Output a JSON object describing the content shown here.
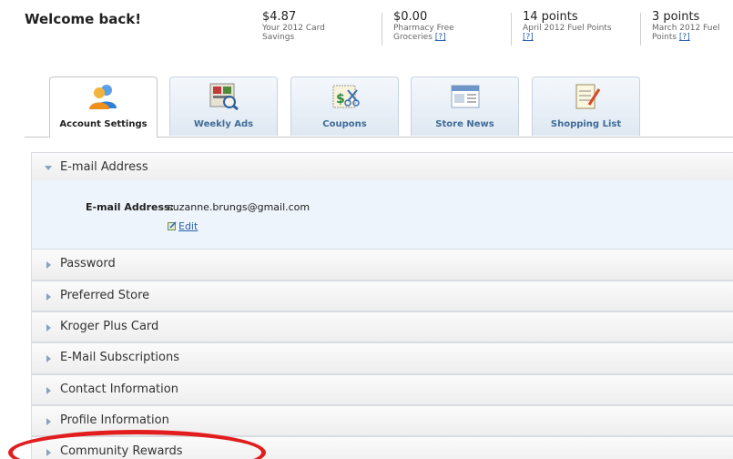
{
  "header": {
    "welcome": "Welcome back!"
  },
  "stats": [
    {
      "value": "$4.87",
      "desc1": "Your 2012 Card",
      "desc2": "Savings",
      "help": ""
    },
    {
      "value": "$0.00",
      "desc1": "Pharmacy Free",
      "desc2": "Groceries",
      "help": "[?]"
    },
    {
      "value": "14 points",
      "desc1": "April 2012 Fuel Points",
      "desc2": "",
      "help": "[?]"
    },
    {
      "value": "3 points",
      "desc1": "March 2012 Fuel",
      "desc2": "Points",
      "help": "[?]"
    }
  ],
  "tabs": [
    {
      "label": "Account Settings",
      "icon": "account-icon",
      "active": true
    },
    {
      "label": "Weekly Ads",
      "icon": "weekly-ads-icon",
      "active": false
    },
    {
      "label": "Coupons",
      "icon": "coupon-icon",
      "active": false
    },
    {
      "label": "Store News",
      "icon": "news-icon",
      "active": false
    },
    {
      "label": "Shopping List",
      "icon": "list-icon",
      "active": false
    }
  ],
  "sections": {
    "email": {
      "title": "E-mail Address",
      "field_label": "E-mail Address:",
      "field_value": "suzanne.brungs@gmail.com",
      "edit_label": "Edit"
    },
    "password": "Password",
    "preferred_store": "Preferred Store",
    "kroger_card": "Kroger Plus Card",
    "email_subscriptions": "E-Mail Subscriptions",
    "contact_info": "Contact Information",
    "profile_info": "Profile Information",
    "community_rewards": "Community Rewards"
  },
  "colors": {
    "annotation": "#e11d1d",
    "link": "#2a60b0",
    "tab_label": "#3f6c98"
  }
}
